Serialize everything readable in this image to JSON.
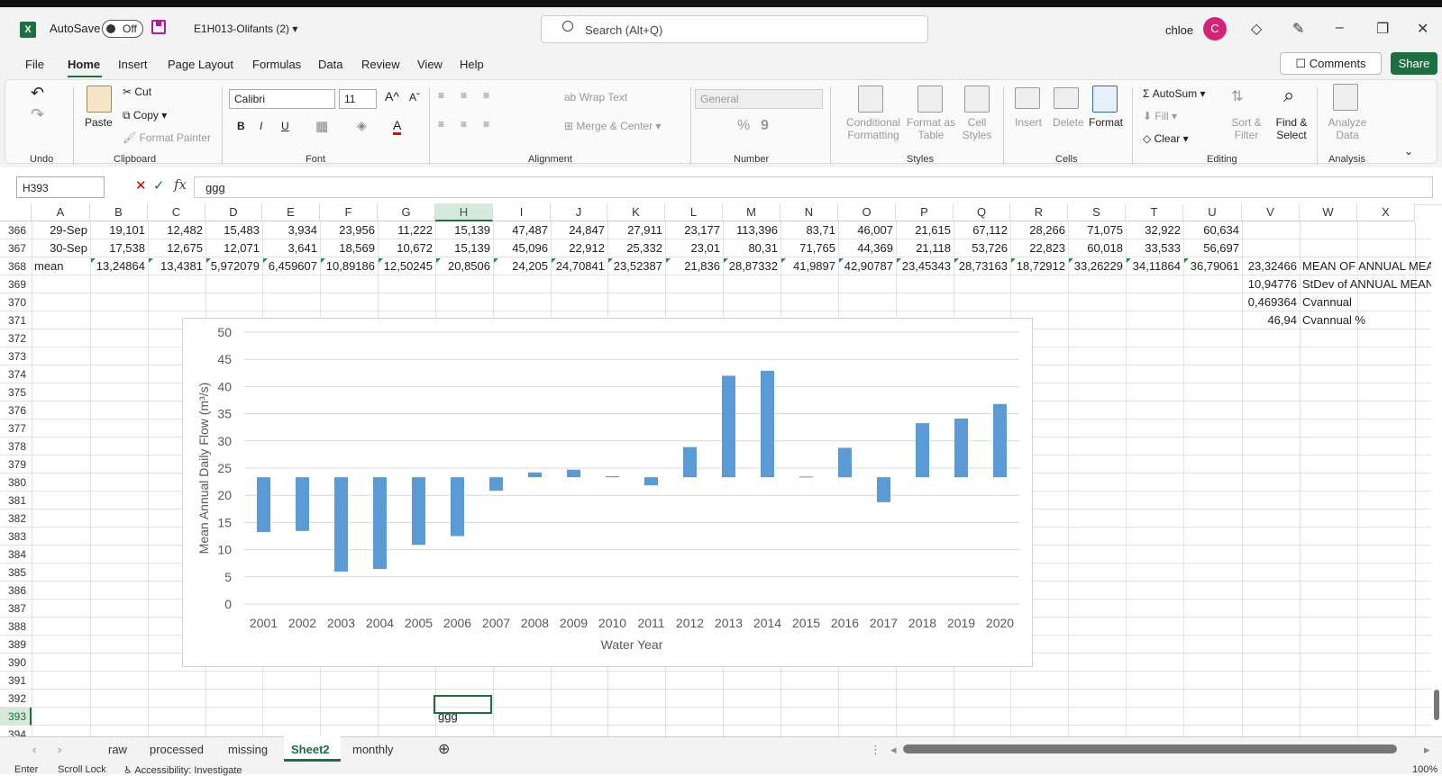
{
  "titlebar": {
    "logo": "X",
    "autosave_label": "AutoSave",
    "autosave_state": "Off",
    "filename": "E1H013-Olifants (2)",
    "search_placeholder": "Search (Alt+Q)",
    "user_name": "chloe",
    "avatar_initial": "C"
  },
  "menu": {
    "items": [
      "File",
      "Home",
      "Insert",
      "Page Layout",
      "Formulas",
      "Data",
      "Review",
      "View",
      "Help"
    ],
    "active": "Home",
    "comments_label": "Comments",
    "share_label": "Share"
  },
  "ribbon": {
    "undo_group": "Undo",
    "clipboard": {
      "paste": "Paste",
      "cut": "Cut",
      "copy": "Copy",
      "format_painter": "Format Painter",
      "group": "Clipboard"
    },
    "font": {
      "name": "Calibri",
      "size": "11",
      "bold": "B",
      "italic": "I",
      "underline": "U",
      "group": "Font"
    },
    "alignment": {
      "wrap_text": "Wrap Text",
      "merge_center": "Merge & Center",
      "group": "Alignment"
    },
    "number": {
      "format": "General",
      "percent": "%",
      "comma": "9",
      "group": "Number"
    },
    "styles": {
      "conditional": "Conditional",
      "conditional2": "Formatting",
      "format_as": "Format as",
      "format_as2": "Table",
      "cell": "Cell",
      "cell2": "Styles",
      "group": "Styles"
    },
    "cells": {
      "insert": "Insert",
      "delete": "Delete",
      "format": "Format",
      "group": "Cells"
    },
    "editing": {
      "autosum": "AutoSum",
      "fill": "Fill",
      "clear": "Clear",
      "sort": "Sort &",
      "sort2": "Filter",
      "find": "Find &",
      "find2": "Select",
      "group": "Editing"
    },
    "analysis": {
      "analyze": "Analyze",
      "analyze2": "Data",
      "group": "Analysis"
    }
  },
  "formula_bar": {
    "name_box": "H393",
    "fx": "fx",
    "content": "ggg"
  },
  "columns": [
    "A",
    "B",
    "C",
    "D",
    "E",
    "F",
    "G",
    "H",
    "I",
    "J",
    "K",
    "L",
    "M",
    "N",
    "O",
    "P",
    "Q",
    "R",
    "S",
    "T",
    "U",
    "V",
    "W",
    "X"
  ],
  "selected_column": "H",
  "row_numbers": [
    "366",
    "367",
    "368",
    "369",
    "370",
    "371",
    "372",
    "373",
    "374",
    "375",
    "376",
    "377",
    "378",
    "379",
    "380",
    "381",
    "382",
    "383",
    "384",
    "385",
    "386",
    "387",
    "388",
    "389",
    "390",
    "391",
    "392",
    "393",
    "394"
  ],
  "selected_row": "393",
  "rows": {
    "r366": [
      "29-Sep",
      "19,101",
      "12,482",
      "15,483",
      "3,934",
      "23,956",
      "11,222",
      "15,139",
      "47,487",
      "24,847",
      "27,911",
      "23,177",
      "113,396",
      "83,71",
      "46,007",
      "21,615",
      "67,112",
      "28,266",
      "71,075",
      "32,922",
      "60,634"
    ],
    "r367": [
      "30-Sep",
      "17,538",
      "12,675",
      "12,071",
      "3,641",
      "18,569",
      "10,672",
      "15,139",
      "45,096",
      "22,912",
      "25,332",
      "23,01",
      "80,31",
      "71,765",
      "44,369",
      "21,118",
      "53,726",
      "22,823",
      "60,018",
      "33,533",
      "56,697"
    ],
    "r368": [
      "mean",
      "13,24864",
      "13,4381",
      "5,972079",
      "6,459607",
      "10,89186",
      "12,50245",
      "20,8506",
      "24,205",
      "24,70841",
      "23,52387",
      "21,836",
      "28,87332",
      "41,9897",
      "42,90787",
      "23,45343",
      "28,73163",
      "18,72912",
      "33,26229",
      "34,11864",
      "36,79061",
      "23,32466",
      "MEAN OF ANNUAL MEAN"
    ]
  },
  "stats": [
    {
      "value": "10,94776",
      "label": "StDev of ANNUAL MEAN"
    },
    {
      "value": "0,469364",
      "label": "Cvannual"
    },
    {
      "value": "46,94",
      "label": "Cvannual %"
    }
  ],
  "active_cell_value": "ggg",
  "chart_data": {
    "type": "bar",
    "baseline": 23.32,
    "categories": [
      "2001",
      "2002",
      "2003",
      "2004",
      "2005",
      "2006",
      "2007",
      "2008",
      "2009",
      "2010",
      "2011",
      "2012",
      "2013",
      "2014",
      "2015",
      "2016",
      "2017",
      "2018",
      "2019",
      "2020"
    ],
    "values": [
      13.25,
      13.44,
      5.97,
      6.46,
      10.89,
      12.5,
      20.85,
      24.21,
      24.71,
      23.52,
      21.84,
      28.87,
      41.99,
      42.91,
      23.45,
      28.73,
      18.73,
      33.26,
      34.12,
      36.79
    ],
    "xlabel": "Water Year",
    "ylabel": "Mean Annual Daily Flow (m³/s)",
    "ylim": [
      0,
      50
    ],
    "yticks": [
      "0",
      "5",
      "10",
      "15",
      "20",
      "25",
      "30",
      "35",
      "40",
      "45",
      "50"
    ],
    "grid": true,
    "bar_color": "#5b9bd5"
  },
  "sheets": {
    "tabs": [
      "raw",
      "processed",
      "missing",
      "Sheet2",
      "monthly"
    ],
    "active": "Sheet2"
  },
  "status": {
    "mode": "Enter",
    "scroll_lock": "Scroll Lock",
    "accessibility": "Accessibility: Investigate",
    "zoom": "100%"
  }
}
